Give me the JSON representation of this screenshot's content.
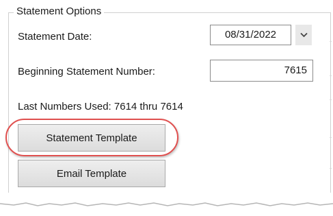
{
  "group": {
    "title": "Statement Options"
  },
  "statement_date": {
    "label": "Statement Date:",
    "value": "08/31/2022"
  },
  "beginning_number": {
    "label": "Beginning Statement Number:",
    "value": "7615"
  },
  "last_numbers": {
    "text": "Last Numbers Used: 7614 thru 7614"
  },
  "buttons": {
    "statement_template": "Statement Template",
    "email_template": "Email Template"
  },
  "icons": {
    "date_dropdown": "chevron-down-icon"
  },
  "colors": {
    "highlight": "#e0504f"
  }
}
